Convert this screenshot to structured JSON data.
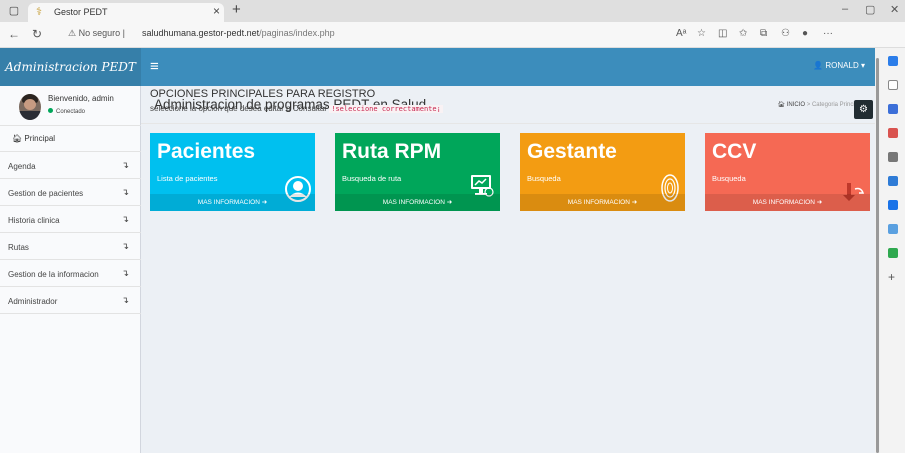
{
  "browser": {
    "tab_title": "Gestor PEDT",
    "tab_close": "×",
    "new_tab": "+",
    "security_label": "No seguro",
    "url_host": "saludhumana.gestor-pedt.net",
    "url_path": "/paginas/index.php",
    "icons": [
      "back-icon",
      "refresh-icon",
      "read-aloud-icon",
      "favorite-icon",
      "split-screen-icon",
      "favorites-icon",
      "collections-icon",
      "extensions-icon",
      "profile-icon",
      "more-icon"
    ]
  },
  "app": {
    "logo": "Administracion PEDT",
    "user_menu": "RONALD",
    "accent": "#3c8dbc"
  },
  "sidebar": {
    "welcome": "Bienvenido, admin",
    "status": "Conectado",
    "main_item": "Principal",
    "items": [
      {
        "label": "Agenda"
      },
      {
        "label": "Gestion de pacientes"
      },
      {
        "label": "Historia clinica"
      },
      {
        "label": "Rutas"
      },
      {
        "label": "Gestion de la informacion"
      },
      {
        "label": "Administrador"
      }
    ]
  },
  "content": {
    "page_title": "Administracion de programas PEDT en Salud",
    "breadcrumb": {
      "home": "INICIO",
      "separator": ">",
      "current": "Categoria Principales"
    },
    "section_title": "OPCIONES PRINCIPALES PARA REGISTRO",
    "section_subtitle": "seleccione la opcion que desea editar o Consultar",
    "section_highlight": "!seleccione correctamente¡"
  },
  "boxes": [
    {
      "title": "Pacientes",
      "desc": "Lista de pacientes",
      "footer": "MAS INFORMACION",
      "color": "#00c0ef",
      "icon": "user-circle-icon"
    },
    {
      "title": "Ruta RPM",
      "desc": "Busqueda de ruta",
      "footer": "MAS INFORMACION",
      "color": "#00a65a",
      "icon": "monitor-icon"
    },
    {
      "title": "Gestante",
      "desc": "Busqueda",
      "footer": "MAS INFORMACION",
      "color": "#f39c12",
      "icon": "fingerprint-icon"
    },
    {
      "title": "CCV",
      "desc": "Busqueda",
      "footer": "MAS INFORMACION",
      "color": "#f56954",
      "icon": "heart-pointer-icon"
    }
  ]
}
